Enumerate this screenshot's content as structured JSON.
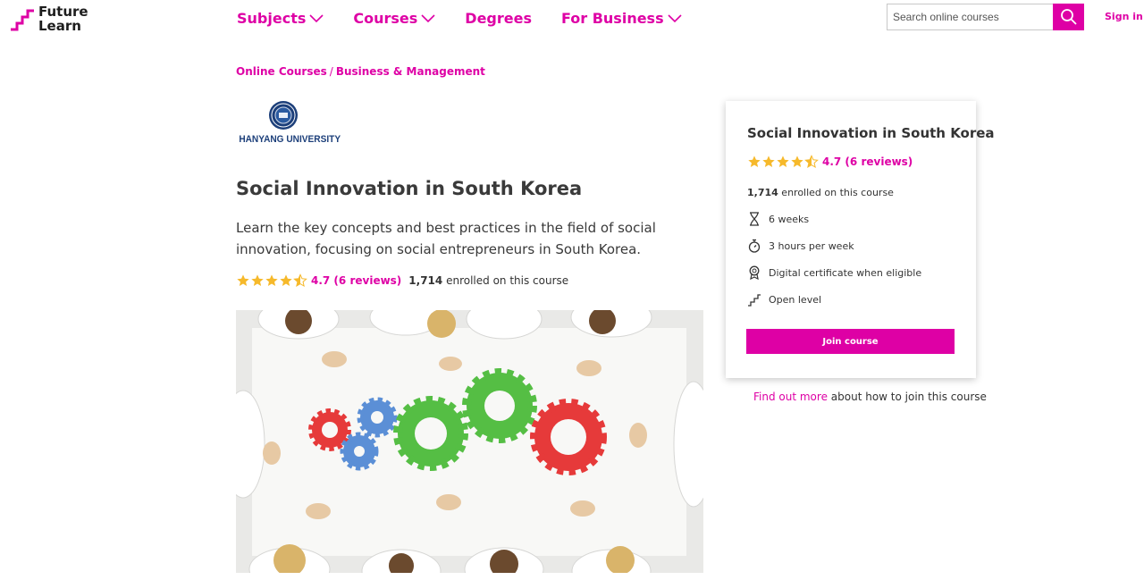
{
  "header": {
    "logo_line1": "Future",
    "logo_line2": "Learn",
    "nav": [
      {
        "label": "Subjects",
        "has_dropdown": true
      },
      {
        "label": "Courses",
        "has_dropdown": true
      },
      {
        "label": "Degrees",
        "has_dropdown": false
      },
      {
        "label": "For Business",
        "has_dropdown": true
      }
    ],
    "search_placeholder": "Search online courses",
    "signin_label": "Sign in"
  },
  "breadcrumb": {
    "items": [
      "Online Courses",
      "Business & Management"
    ],
    "separator": "/"
  },
  "university": {
    "name": "HANYANG UNIVERSITY"
  },
  "course": {
    "title": "Social Innovation in South Korea",
    "description": "Learn the key concepts and best practices in the field of social innovation, focusing on social entrepreneurs in South Korea.",
    "rating_value": 4.7,
    "rating_text": "4.7 (6 reviews)",
    "enrolled_count": "1,714",
    "enrolled_suffix": "enrolled on this course"
  },
  "card": {
    "title": "Social Innovation in South Korea",
    "rating_text": "4.7 (6 reviews)",
    "enrolled_count": "1,714",
    "enrolled_suffix": "enrolled on this course",
    "features": [
      {
        "icon": "hourglass-icon",
        "label": "6 weeks"
      },
      {
        "icon": "stopwatch-icon",
        "label": "3 hours per week"
      },
      {
        "icon": "certificate-icon",
        "label": "Digital certificate when eligible"
      },
      {
        "icon": "stairs-icon",
        "label": "Open level"
      }
    ],
    "join_label": "Join course"
  },
  "footer_note": {
    "link_text": "Find out more",
    "rest_text": "about how to join this course"
  },
  "colors": {
    "brand": "#de00a5",
    "star": "#f6b92b",
    "text": "#333333"
  }
}
